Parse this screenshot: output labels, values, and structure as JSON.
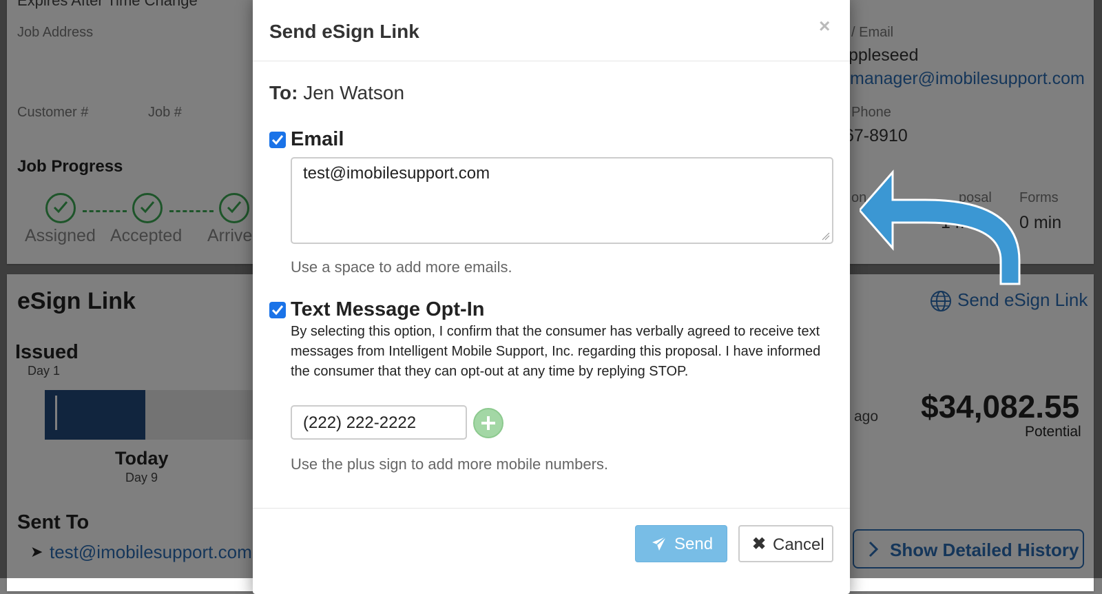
{
  "background": {
    "top_card": {
      "expires_label": "Expires After Time Change",
      "job_address_label": "Job Address",
      "customer_no_label": "Customer #",
      "job_no_label": "Job #",
      "contact_header_partial": "/ Email",
      "contact_name_partial": "ppleseed",
      "contact_email_partial": "manager@imobilesupport.com",
      "phone_label_partial": "Phone",
      "phone_partial": "67-8910",
      "job_progress_title": "Job Progress",
      "progress_steps": [
        "Assigned",
        "Accepted",
        "Arrive"
      ],
      "col_partial_on": "on",
      "col_proposal_partial": "posal",
      "col_proposal_value_partial": "1 m",
      "col_forms_label": "Forms",
      "col_forms_value": "0 min"
    },
    "esign_card": {
      "title": "eSign Link",
      "send_link_label": "Send eSign Link",
      "issued_label": "Issued",
      "issued_day": "Day 1",
      "today_label": "Today",
      "today_day": "Day 9",
      "ago_label": "ago",
      "amount": "$34,082.55",
      "amount_caption": "Potential",
      "sent_to_title": "Sent To",
      "sent_to_arrow": "➤",
      "sent_to_email": "test@imobilesupport.com",
      "history_button": "Show Detailed History"
    }
  },
  "modal": {
    "title": "Send eSign Link",
    "close_glyph": "×",
    "to_label": "To:",
    "to_name": "Jen Watson",
    "email_section": {
      "label": "Email",
      "checked": true,
      "value": "test@imobilesupport.com",
      "help": "Use a space to add more emails."
    },
    "sms_section": {
      "label": "Text Message Opt-In",
      "checked": true,
      "consent_text": "By selecting this option, I confirm that the consumer has verbally agreed to receive text messages from Intelligent Mobile Support, Inc. regarding this proposal. I have informed the consumer that they can opt-out at any time by replying STOP.",
      "phone_value": "(222) 222-2222",
      "help": "Use the plus sign to add more mobile numbers."
    },
    "footer": {
      "send_label": "Send",
      "cancel_label": "Cancel",
      "cancel_glyph": "✖"
    }
  },
  "colors": {
    "arrow": "#3b97d3",
    "progress_green": "#3cab54",
    "link_blue": "#2a6db5",
    "checkbox_blue": "#1a73e8",
    "timeline_fill": "#224b7d"
  },
  "icons": {
    "arrow": "curved-arrow-icon",
    "globe": "globe-icon",
    "send": "paper-plane-icon",
    "cancel": "x-icon",
    "chevron": "chevron-right-icon",
    "check": "check-icon"
  }
}
